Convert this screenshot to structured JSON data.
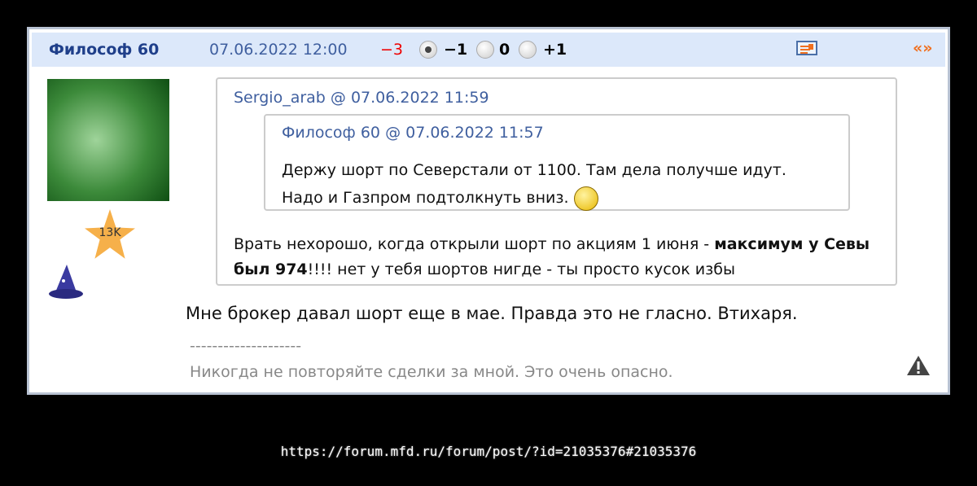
{
  "post": {
    "author": "Философ 60",
    "date": "07.06.2022 12:00",
    "score": "−3",
    "votes": [
      {
        "label": "−1",
        "selected": true
      },
      {
        "label": "0",
        "selected": false
      },
      {
        "label": "+1",
        "selected": false
      }
    ],
    "nav": "«»",
    "rating_badge": "13K",
    "quote": {
      "author": "Sergio_arab",
      "at": "@",
      "date": "07.06.2022 11:59",
      "inner": {
        "author": "Философ 60",
        "at": "@",
        "date": "07.06.2022 11:57",
        "line1": "Держу шорт по Северстали от 1100. Там дела получше идут.",
        "line2": "Надо и Газпром подтолкнуть вниз."
      },
      "text_pre": "Врать нехорошо, когда открыли шорт по акциям 1 июня - ",
      "text_bold": "максимум у Севы был 974",
      "text_post": "!!!! нет у тебя шортов нигде - ты просто кусок избы"
    },
    "body": "Мне брокер давал шорт еще в мае. Правда это не гласно. Втихаря.",
    "sig_sep": "--------------------",
    "signature": "Никогда не повторяйте сделки за мной. Это очень опасно."
  },
  "url": "https://forum.mfd.ru/forum/post/?id=21035376#21035376"
}
